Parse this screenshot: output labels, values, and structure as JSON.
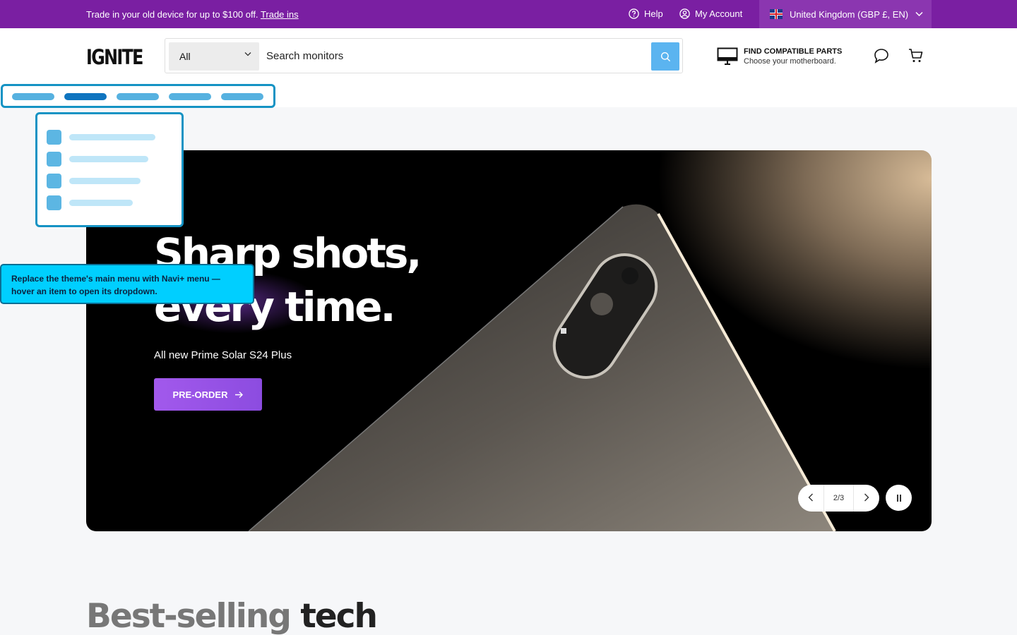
{
  "announcement": {
    "promo_text": "Trade in your old device for up to $100 off.",
    "promo_link": "Trade ins",
    "help": "Help",
    "account": "My Account",
    "locale": "United Kingdom (GBP £, EN)"
  },
  "header": {
    "logo": "IGNITE",
    "search_category": "All",
    "search_placeholder": "Search monitors",
    "parts_title": "FIND COMPATIBLE PARTS",
    "parts_subtitle": "Choose your motherboard."
  },
  "tooltip": {
    "line1": "Replace the theme's main menu with Navi+ menu —",
    "line2": "hover an item to open its dropdown."
  },
  "hero": {
    "headline_line1": "Sharp shots,",
    "headline_line2": "every time.",
    "subtitle": "All new Prime Solar S24 Plus",
    "cta": "PRE-ORDER",
    "slide_counter": "2/3"
  },
  "section": {
    "title_muted": "Best-selling",
    "title_main": "tech"
  },
  "colors": {
    "announcement_bg": "#7a1fa2",
    "search_button": "#5bb4f0",
    "cta_gradient_start": "#a259ec",
    "navi_outline": "#1593c4",
    "tooltip_bg": "#00cfff"
  }
}
